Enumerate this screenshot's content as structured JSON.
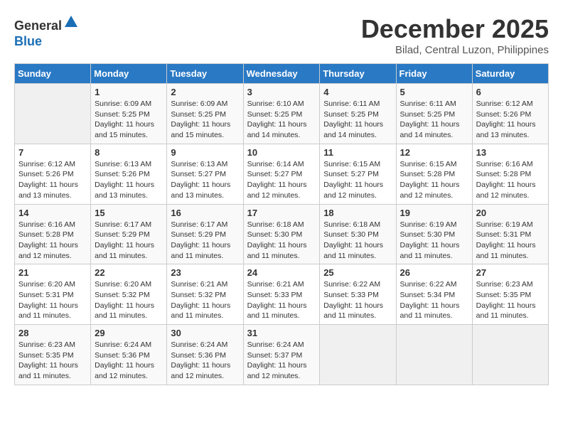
{
  "header": {
    "logo_line1": "General",
    "logo_line2": "Blue",
    "month_title": "December 2025",
    "location": "Bilad, Central Luzon, Philippines"
  },
  "weekdays": [
    "Sunday",
    "Monday",
    "Tuesday",
    "Wednesday",
    "Thursday",
    "Friday",
    "Saturday"
  ],
  "weeks": [
    [
      {
        "day": "",
        "info": ""
      },
      {
        "day": "1",
        "info": "Sunrise: 6:09 AM\nSunset: 5:25 PM\nDaylight: 11 hours and 15 minutes."
      },
      {
        "day": "2",
        "info": "Sunrise: 6:09 AM\nSunset: 5:25 PM\nDaylight: 11 hours and 15 minutes."
      },
      {
        "day": "3",
        "info": "Sunrise: 6:10 AM\nSunset: 5:25 PM\nDaylight: 11 hours and 14 minutes."
      },
      {
        "day": "4",
        "info": "Sunrise: 6:11 AM\nSunset: 5:25 PM\nDaylight: 11 hours and 14 minutes."
      },
      {
        "day": "5",
        "info": "Sunrise: 6:11 AM\nSunset: 5:25 PM\nDaylight: 11 hours and 14 minutes."
      },
      {
        "day": "6",
        "info": "Sunrise: 6:12 AM\nSunset: 5:26 PM\nDaylight: 11 hours and 13 minutes."
      }
    ],
    [
      {
        "day": "7",
        "info": "Sunrise: 6:12 AM\nSunset: 5:26 PM\nDaylight: 11 hours and 13 minutes."
      },
      {
        "day": "8",
        "info": "Sunrise: 6:13 AM\nSunset: 5:26 PM\nDaylight: 11 hours and 13 minutes."
      },
      {
        "day": "9",
        "info": "Sunrise: 6:13 AM\nSunset: 5:27 PM\nDaylight: 11 hours and 13 minutes."
      },
      {
        "day": "10",
        "info": "Sunrise: 6:14 AM\nSunset: 5:27 PM\nDaylight: 11 hours and 12 minutes."
      },
      {
        "day": "11",
        "info": "Sunrise: 6:15 AM\nSunset: 5:27 PM\nDaylight: 11 hours and 12 minutes."
      },
      {
        "day": "12",
        "info": "Sunrise: 6:15 AM\nSunset: 5:28 PM\nDaylight: 11 hours and 12 minutes."
      },
      {
        "day": "13",
        "info": "Sunrise: 6:16 AM\nSunset: 5:28 PM\nDaylight: 11 hours and 12 minutes."
      }
    ],
    [
      {
        "day": "14",
        "info": "Sunrise: 6:16 AM\nSunset: 5:28 PM\nDaylight: 11 hours and 12 minutes."
      },
      {
        "day": "15",
        "info": "Sunrise: 6:17 AM\nSunset: 5:29 PM\nDaylight: 11 hours and 11 minutes."
      },
      {
        "day": "16",
        "info": "Sunrise: 6:17 AM\nSunset: 5:29 PM\nDaylight: 11 hours and 11 minutes."
      },
      {
        "day": "17",
        "info": "Sunrise: 6:18 AM\nSunset: 5:30 PM\nDaylight: 11 hours and 11 minutes."
      },
      {
        "day": "18",
        "info": "Sunrise: 6:18 AM\nSunset: 5:30 PM\nDaylight: 11 hours and 11 minutes."
      },
      {
        "day": "19",
        "info": "Sunrise: 6:19 AM\nSunset: 5:30 PM\nDaylight: 11 hours and 11 minutes."
      },
      {
        "day": "20",
        "info": "Sunrise: 6:19 AM\nSunset: 5:31 PM\nDaylight: 11 hours and 11 minutes."
      }
    ],
    [
      {
        "day": "21",
        "info": "Sunrise: 6:20 AM\nSunset: 5:31 PM\nDaylight: 11 hours and 11 minutes."
      },
      {
        "day": "22",
        "info": "Sunrise: 6:20 AM\nSunset: 5:32 PM\nDaylight: 11 hours and 11 minutes."
      },
      {
        "day": "23",
        "info": "Sunrise: 6:21 AM\nSunset: 5:32 PM\nDaylight: 11 hours and 11 minutes."
      },
      {
        "day": "24",
        "info": "Sunrise: 6:21 AM\nSunset: 5:33 PM\nDaylight: 11 hours and 11 minutes."
      },
      {
        "day": "25",
        "info": "Sunrise: 6:22 AM\nSunset: 5:33 PM\nDaylight: 11 hours and 11 minutes."
      },
      {
        "day": "26",
        "info": "Sunrise: 6:22 AM\nSunset: 5:34 PM\nDaylight: 11 hours and 11 minutes."
      },
      {
        "day": "27",
        "info": "Sunrise: 6:23 AM\nSunset: 5:35 PM\nDaylight: 11 hours and 11 minutes."
      }
    ],
    [
      {
        "day": "28",
        "info": "Sunrise: 6:23 AM\nSunset: 5:35 PM\nDaylight: 11 hours and 11 minutes."
      },
      {
        "day": "29",
        "info": "Sunrise: 6:24 AM\nSunset: 5:36 PM\nDaylight: 11 hours and 12 minutes."
      },
      {
        "day": "30",
        "info": "Sunrise: 6:24 AM\nSunset: 5:36 PM\nDaylight: 11 hours and 12 minutes."
      },
      {
        "day": "31",
        "info": "Sunrise: 6:24 AM\nSunset: 5:37 PM\nDaylight: 11 hours and 12 minutes."
      },
      {
        "day": "",
        "info": ""
      },
      {
        "day": "",
        "info": ""
      },
      {
        "day": "",
        "info": ""
      }
    ]
  ]
}
